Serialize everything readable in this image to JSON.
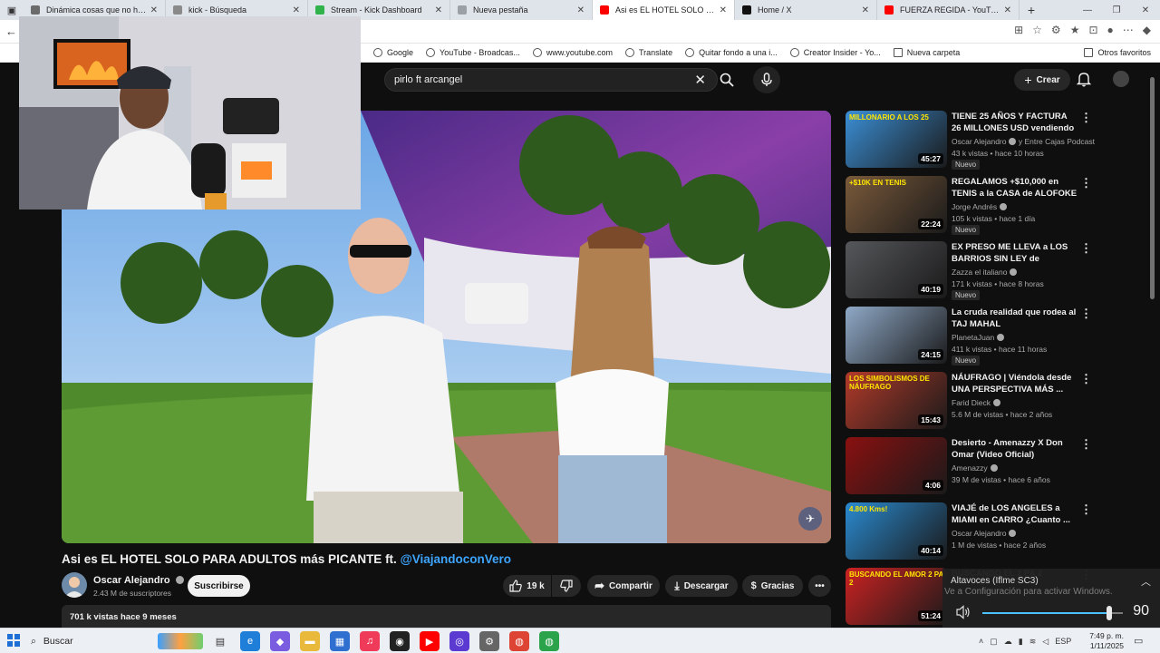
{
  "browser": {
    "tabs": [
      {
        "title": "Dinámica cosas que no haría",
        "color": "#6b6b6b",
        "active": false
      },
      {
        "title": "kick - Búsqueda",
        "color": "#8a8a8a",
        "active": false
      },
      {
        "title": "Stream - Kick Dashboard",
        "color": "#2fb34a",
        "active": false
      },
      {
        "title": "Nueva pestaña",
        "color": "#9aa0a6",
        "active": false
      },
      {
        "title": "Asi es EL HOTEL SOLO PARA ADULTOS",
        "color": "#ff0000",
        "active": true
      },
      {
        "title": "Home / X",
        "color": "#111111",
        "active": false
      },
      {
        "title": "FUERZA REGIDA - YouTube",
        "color": "#ff0000",
        "active": false
      }
    ]
  },
  "bookmarks": {
    "items": [
      {
        "label": "Google"
      },
      {
        "label": "YouTube - Broadcas..."
      },
      {
        "label": "www.youtube.com"
      },
      {
        "label": "Translate"
      },
      {
        "label": "Quitar fondo a una i..."
      },
      {
        "label": "Creator Insider - Yo..."
      },
      {
        "label": "Nueva carpeta"
      }
    ],
    "otros": "Otros favoritos"
  },
  "youtube": {
    "search_query": "pirlo ft arcangel",
    "create_label": "Crear",
    "video": {
      "title_main": "Asi es EL HOTEL SOLO PARA ADULTOS más PICANTE ft.",
      "title_handle": "@ViajandoconVero",
      "channel": "Oscar Alejandro",
      "subscribers": "2.43 M de suscriptores",
      "subscribe_label": "Suscribirse",
      "likes": "19 k",
      "share_label": "Compartir",
      "download_label": "Descargar",
      "thanks_label": "Gracias",
      "stats": "701 k vistas  hace 9 meses"
    },
    "recommendations": [
      {
        "title": "TIENE 25 AÑOS Y FACTURA 26 MILLONES USD vendiendo en ...",
        "channel": "Oscar Alejandro",
        "channel_extra": " y Entre Cajas Podcast",
        "meta": "43 k vistas • hace 10 horas",
        "duration": "45:27",
        "badge": "Nuevo",
        "thumb_text": "MILLONARIO A LOS 25",
        "thumb_color": "#3b8fd6"
      },
      {
        "title": "REGALAMOS +$10,000 en TENIS a la CASA de ALOFOKE",
        "channel": "Jorge Andrés",
        "channel_extra": "",
        "meta": "105 k vistas • hace 1 día",
        "duration": "22:24",
        "badge": "Nuevo",
        "thumb_text": "+$10K EN TENIS",
        "thumb_color": "#7a5a3a"
      },
      {
        "title": "EX PRESO ME LLEVA a LOS BARRIOS SIN LEY de ROSARI...",
        "channel": "Zazza el italiano",
        "channel_extra": "",
        "meta": "171 k vistas • hace 8 horas",
        "duration": "40:19",
        "badge": "Nuevo",
        "thumb_text": "",
        "thumb_color": "#55575a"
      },
      {
        "title": "La cruda realidad que rodea al TAJ MAHAL",
        "channel": "PlanetaJuan",
        "channel_extra": "",
        "meta": "411 k vistas • hace 11 horas",
        "duration": "24:15",
        "badge": "Nuevo",
        "thumb_text": "",
        "thumb_color": "#8fa9c7"
      },
      {
        "title": "NÁUFRAGO | Viéndola desde UNA PERSPECTIVA MÁS ...",
        "channel": "Farid Dieck",
        "channel_extra": "",
        "meta": "5.6 M de vistas • hace 2 años",
        "duration": "15:43",
        "badge": "",
        "thumb_text": "LOS SIMBOLISMOS DE NÁUFRAGO",
        "thumb_color": "#b23a2a"
      },
      {
        "title": "Desierto - Amenazzy X Don Omar (Video Oficial)",
        "channel": "Amenazzy",
        "channel_extra": "",
        "meta": "39 M de vistas • hace 6 años",
        "duration": "4:06",
        "badge": "",
        "thumb_text": "",
        "thumb_color": "#8a1010"
      },
      {
        "title": "VIAJÉ de LOS ANGELES a MIAMI en CARRO ¿Cuanto ...",
        "channel": "Oscar Alejandro",
        "channel_extra": "",
        "meta": "1 M de vistas • hace 2 años",
        "duration": "40:14",
        "badge": "",
        "thumb_text": "4.800 Kms!",
        "thumb_color": "#2a8ad0"
      },
      {
        "title": "BUSCANDO EL 2 PA 2",
        "channel": "",
        "channel_extra": "",
        "meta": "",
        "duration": "51:24",
        "badge": "",
        "thumb_text": "BUSCANDO EL AMOR 2 PA 2",
        "thumb_color": "#c22"
      }
    ]
  },
  "volume_flyout": {
    "device": "Altavoces (Iflme SC3)",
    "watermark": "Ve a Configuración para activar Windows.",
    "level": 90,
    "level_label": "90"
  },
  "taskbar": {
    "search_label": "Buscar",
    "lang": "ESP",
    "time": "7:49 p. m.",
    "date": "1/11/2025"
  },
  "colors": {
    "yt_bg": "#0f0f0f",
    "accent_link": "#3ea6ff",
    "yt_red": "#ff0000",
    "volume_fill": "#4cc2ff"
  }
}
